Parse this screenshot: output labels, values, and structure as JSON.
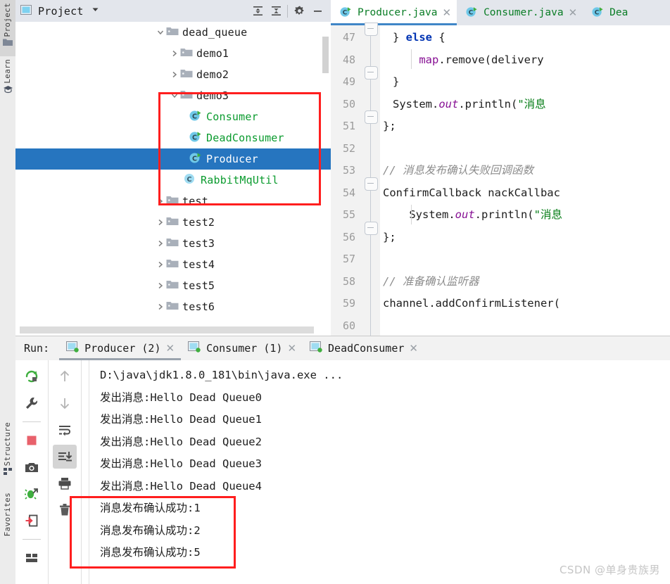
{
  "left_strip": {
    "tabs": [
      {
        "label": "Project",
        "icon": "folder-icon",
        "selected": true
      },
      {
        "label": "Learn",
        "icon": "graduation-cap-icon",
        "selected": false
      },
      {
        "label": "Structure",
        "icon": "structure-icon",
        "selected": false
      },
      {
        "label": "Favorites",
        "icon": "favorites-icon",
        "selected": false
      }
    ]
  },
  "project_panel": {
    "title": "Project",
    "dropdown_icon": "chevron-down-icon",
    "window_icon": "project-window-icon",
    "toolbar": [
      {
        "name": "expand-all-icon",
        "label": "Expand All"
      },
      {
        "name": "collapse-all-icon",
        "label": "Collapse All"
      },
      {
        "name": "gear-icon",
        "label": "Settings"
      },
      {
        "name": "minimize-icon",
        "label": "Hide"
      }
    ],
    "tree": [
      {
        "label": "dead_queue",
        "type": "folder",
        "indent": 0,
        "arrow": "down",
        "selected": false
      },
      {
        "label": "demo1",
        "type": "folder",
        "indent": 1,
        "arrow": "right",
        "selected": false
      },
      {
        "label": "demo2",
        "type": "folder",
        "indent": 1,
        "arrow": "right",
        "selected": false
      },
      {
        "label": "demo3",
        "type": "folder",
        "indent": 1,
        "arrow": "down",
        "selected": false
      },
      {
        "label": "Consumer",
        "type": "class-runnable",
        "indent": 2,
        "arrow": "none",
        "selected": false
      },
      {
        "label": "DeadConsumer",
        "type": "class-runnable",
        "indent": 2,
        "arrow": "none",
        "selected": false
      },
      {
        "label": "Producer",
        "type": "class-runnable",
        "indent": 2,
        "arrow": "none",
        "selected": true
      },
      {
        "label": "RabbitMqUtil",
        "type": "class",
        "indent": 2,
        "arrow": "none",
        "selected": false
      },
      {
        "label": "test",
        "type": "folder",
        "indent": 1,
        "arrow": "right",
        "selected": false
      },
      {
        "label": "test2",
        "type": "folder",
        "indent": 1,
        "arrow": "right",
        "selected": false
      },
      {
        "label": "test3",
        "type": "folder",
        "indent": 1,
        "arrow": "right",
        "selected": false
      },
      {
        "label": "test4",
        "type": "folder",
        "indent": 1,
        "arrow": "right",
        "selected": false
      },
      {
        "label": "test5",
        "type": "folder",
        "indent": 1,
        "arrow": "right",
        "selected": false
      },
      {
        "label": "test6",
        "type": "folder",
        "indent": 1,
        "arrow": "right",
        "selected": false
      }
    ]
  },
  "editor": {
    "tabs": [
      {
        "label": "Producer.java",
        "icon": "java-class-runnable-icon",
        "active": true,
        "close_icon": "close-icon"
      },
      {
        "label": "Consumer.java",
        "icon": "java-class-runnable-icon",
        "active": false,
        "close_icon": "close-icon"
      },
      {
        "label": "Dea",
        "icon": "java-class-runnable-icon",
        "active": false,
        "close_icon": "close-icon"
      }
    ],
    "line_numbers": [
      "47",
      "48",
      "49",
      "50",
      "51",
      "52",
      "53",
      "54",
      "55",
      "56",
      "57",
      "58",
      "59",
      "60"
    ],
    "code_lines": [
      [
        {
          "t": "} ",
          "c": "pln"
        },
        {
          "t": "else",
          "c": "kw"
        },
        {
          "t": " {",
          "c": "pln"
        }
      ],
      [
        {
          "t": "    ",
          "c": "pln"
        },
        {
          "t": "map",
          "c": "fld"
        },
        {
          "t": ".remove(delivery",
          "c": "pln"
        }
      ],
      [
        {
          "t": "}",
          "c": "pln"
        }
      ],
      [
        {
          "t": "System.",
          "c": "pln"
        },
        {
          "t": "out",
          "c": "stat"
        },
        {
          "t": ".println(",
          "c": "pln"
        },
        {
          "t": "\"消息",
          "c": "str"
        }
      ],
      [
        {
          "t": "};",
          "c": "pln"
        }
      ],
      [
        {
          "t": "",
          "c": "pln"
        }
      ],
      [
        {
          "t": "// 消息发布确认失败回调函数",
          "c": "cmt"
        }
      ],
      [
        {
          "t": "ConfirmCallback nackCallbac",
          "c": "pln"
        }
      ],
      [
        {
          "t": "    System.",
          "c": "pln"
        },
        {
          "t": "out",
          "c": "stat"
        },
        {
          "t": ".println(",
          "c": "pln"
        },
        {
          "t": "\"消息",
          "c": "str"
        }
      ],
      [
        {
          "t": "};",
          "c": "pln"
        }
      ],
      [
        {
          "t": "",
          "c": "pln"
        }
      ],
      [
        {
          "t": "// 准备确认监听器",
          "c": "cmt"
        }
      ],
      [
        {
          "t": "channel.addConfirmListener(",
          "c": "pln"
        }
      ],
      [
        {
          "t": "",
          "c": "pln"
        }
      ]
    ]
  },
  "run_panel": {
    "label": "Run:",
    "tabs": [
      {
        "label": "Producer (2)",
        "icon": "run-config-icon",
        "active": true,
        "close_icon": "close-icon"
      },
      {
        "label": "Consumer (1)",
        "icon": "run-config-icon",
        "active": false,
        "close_icon": "close-icon"
      },
      {
        "label": "DeadConsumer",
        "icon": "run-config-icon",
        "active": false,
        "close_icon": "close-icon"
      }
    ],
    "toolbar_left": [
      {
        "name": "rerun-icon",
        "label": "Rerun"
      },
      {
        "name": "wrench-icon",
        "label": "Edit Configuration"
      },
      {
        "name": "stop-icon",
        "label": "Stop"
      },
      {
        "name": "camera-icon",
        "label": "Capture Memory Snapshot"
      },
      {
        "name": "debug-icon",
        "label": "Attach Debugger"
      },
      {
        "name": "export-icon",
        "label": "Export"
      },
      {
        "name": "layout-icon",
        "label": "Layout Settings"
      }
    ],
    "toolbar_right": [
      {
        "name": "arrow-up-icon",
        "label": "Up the Stack Trace",
        "state": "disabled"
      },
      {
        "name": "arrow-down-icon",
        "label": "Down the Stack Trace",
        "state": "disabled"
      },
      {
        "name": "soft-wrap-icon",
        "label": "Use Soft Wraps",
        "state": "normal"
      },
      {
        "name": "scroll-to-end-icon",
        "label": "Scroll to the End",
        "state": "active"
      },
      {
        "name": "print-icon",
        "label": "Print",
        "state": "normal"
      },
      {
        "name": "trash-icon",
        "label": "Clear All",
        "state": "normal"
      }
    ],
    "console": [
      {
        "text": "D:\\java\\jdk1.8.0_181\\bin\\java.exe ...",
        "kind": "command"
      },
      {
        "text": "发出消息:Hello Dead Queue0",
        "kind": "out"
      },
      {
        "text": "发出消息:Hello Dead Queue1",
        "kind": "out"
      },
      {
        "text": "发出消息:Hello Dead Queue2",
        "kind": "out"
      },
      {
        "text": "发出消息:Hello Dead Queue3",
        "kind": "out"
      },
      {
        "text": "发出消息:Hello Dead Queue4",
        "kind": "out"
      },
      {
        "text": "消息发布确认成功:1",
        "kind": "out"
      },
      {
        "text": "消息发布确认成功:2",
        "kind": "out"
      },
      {
        "text": "消息发布确认成功:5",
        "kind": "out"
      }
    ]
  },
  "annotations": {
    "highlight_color": "#ff1e1e",
    "boxes": [
      {
        "name": "tree-demo3-highlight"
      },
      {
        "name": "console-confirm-highlight"
      }
    ]
  },
  "watermark": {
    "text": "CSDN @单身贵族男"
  },
  "colors": {
    "selection_blue": "#2675bf",
    "tab_active_underline": "#4086c7",
    "class_green": "#0a9b2e",
    "keyword_blue": "#0033b3",
    "string_green": "#067d17",
    "field_purple": "#871094",
    "comment_gray": "#8c8c8c"
  }
}
